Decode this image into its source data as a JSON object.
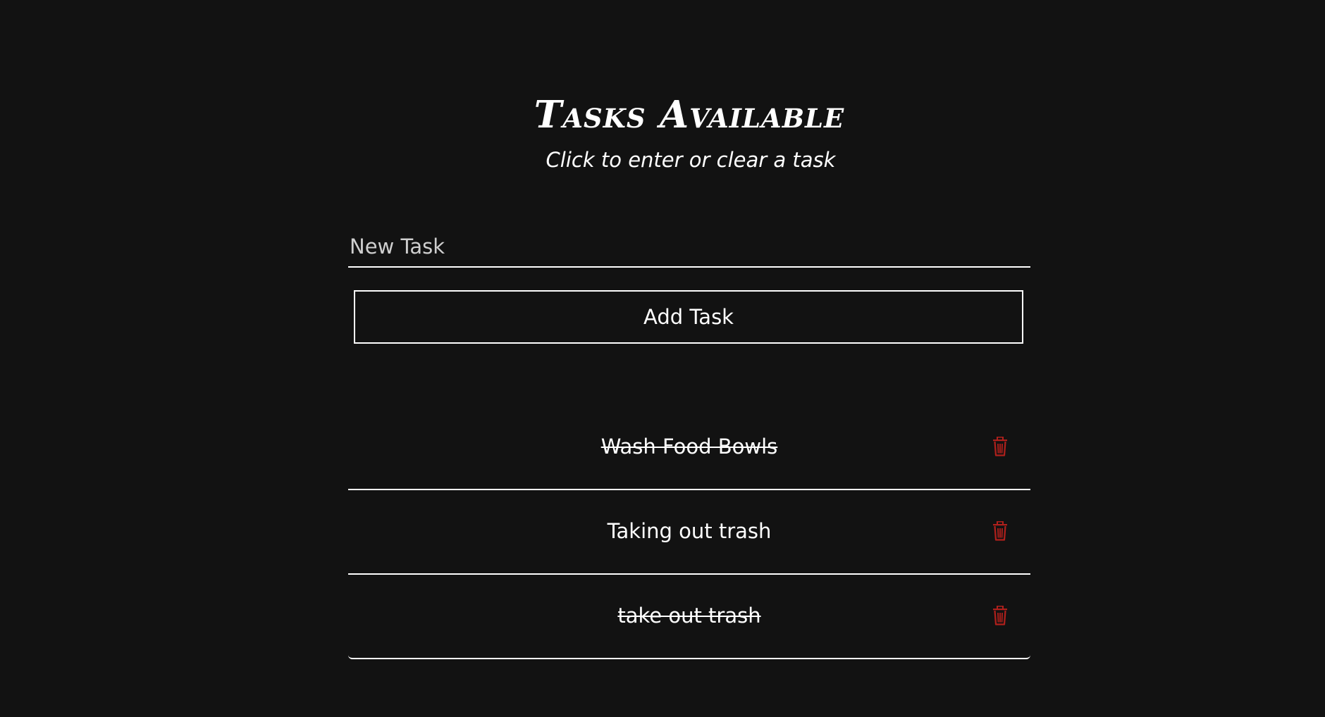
{
  "header": {
    "title": "Tasks Available",
    "subtitle": "Click to enter or clear a task"
  },
  "form": {
    "input_placeholder": "New Task",
    "input_value": "",
    "add_button_label": "Add Task"
  },
  "tasks": [
    {
      "text": "Wash Food Bowls",
      "completed": true,
      "delete_icon": "trash-icon"
    },
    {
      "text": "Taking out trash",
      "completed": false,
      "delete_icon": "trash-icon"
    },
    {
      "text": "take out trash",
      "completed": true,
      "delete_icon": "trash-icon"
    }
  ],
  "colors": {
    "background": "#121212",
    "text": "#ffffff",
    "delete_icon": "#b0201c"
  }
}
